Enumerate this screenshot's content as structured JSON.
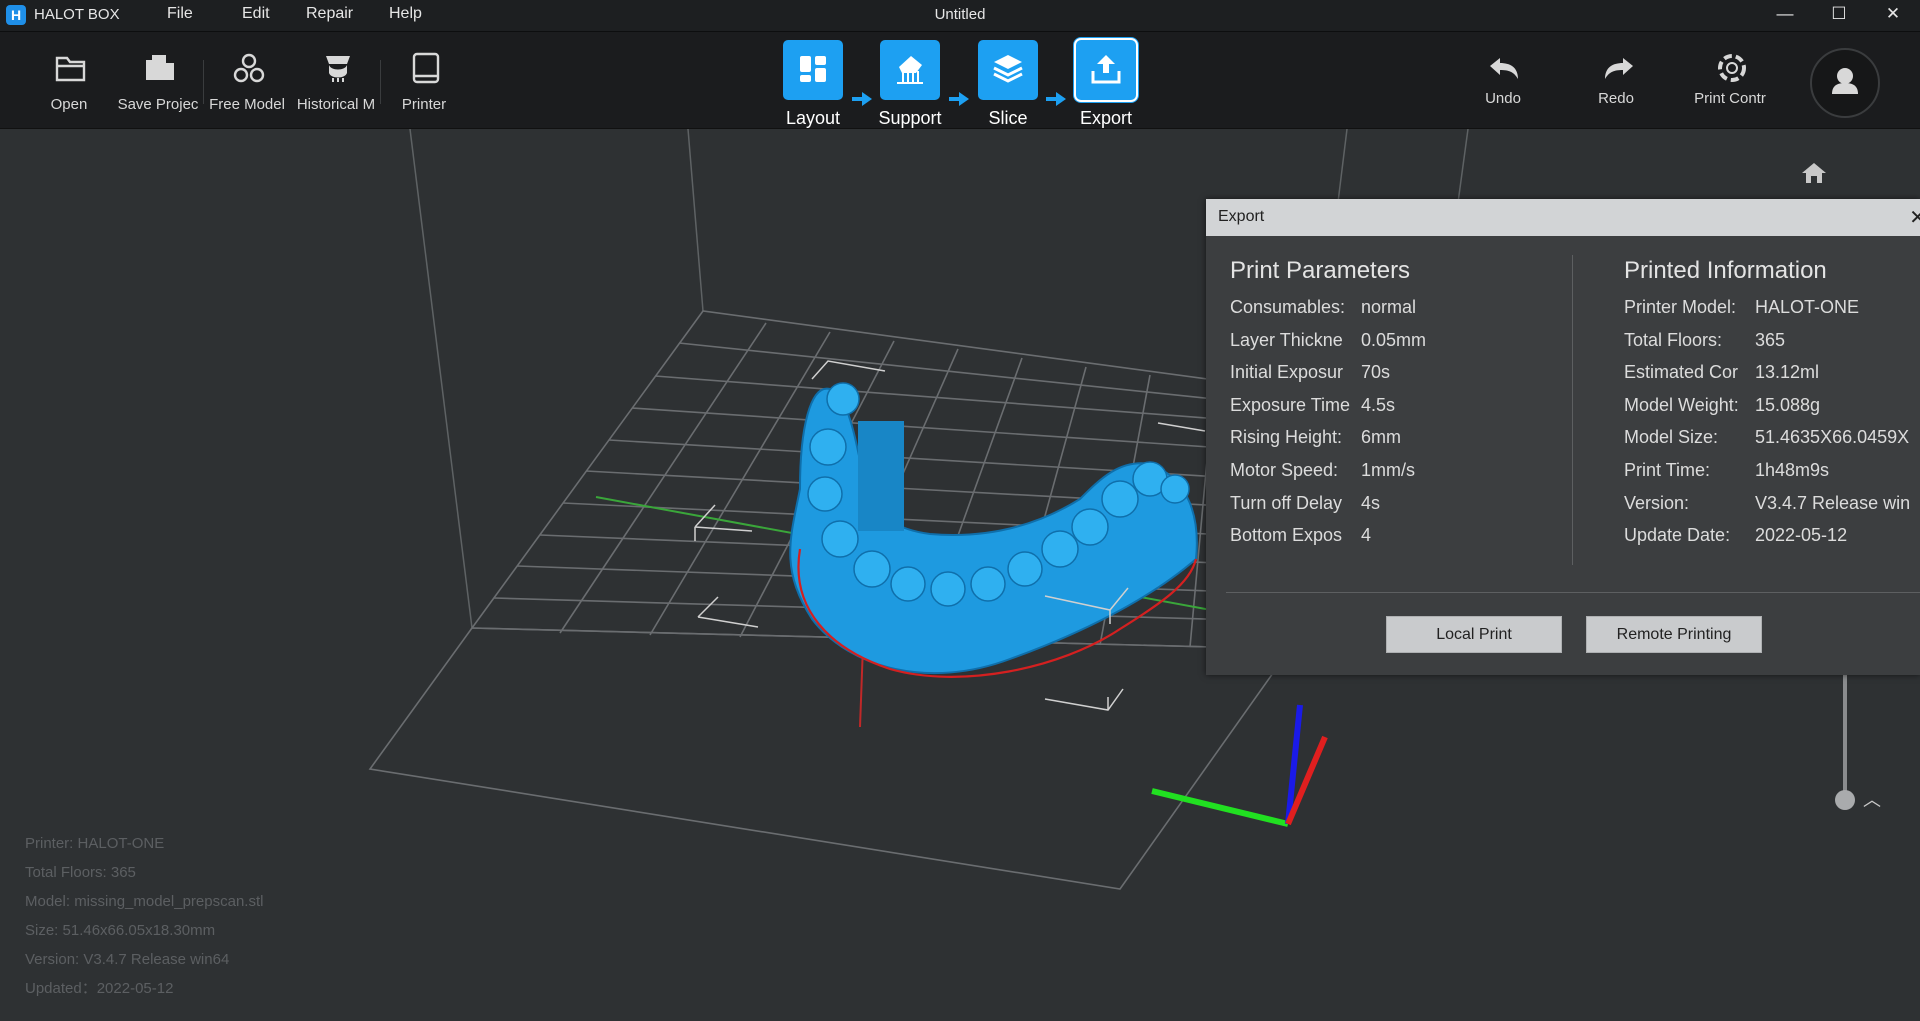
{
  "app": {
    "logo_letter": "H",
    "name": "HALOT BOX",
    "window_title": "Untitled"
  },
  "menu": {
    "file": "File",
    "edit": "Edit",
    "repair": "Repair",
    "help": "Help"
  },
  "window_controls": {
    "minimize": "—",
    "maximize": "☐",
    "close": "✕"
  },
  "toolbar": {
    "open": "Open",
    "save_project": "Save Projec",
    "free_model": "Free Model",
    "historical": "Historical M",
    "printer": "Printer",
    "undo": "Undo",
    "redo": "Redo",
    "print_control": "Print Contr"
  },
  "steps": {
    "layout": "Layout",
    "support": "Support",
    "slice": "Slice",
    "export": "Export",
    "active": "Export"
  },
  "info_panel": {
    "printer": "Printer: HALOT-ONE",
    "total_floors": "Total Floors: 365",
    "model": "Model: missing_model_prepscan.stl",
    "size": "Size: 51.46x66.05x18.30mm",
    "version": "Version: V3.4.7 Release win64",
    "updated": "Updated：2022-05-12"
  },
  "export_dialog": {
    "title": "Export",
    "close": "✕",
    "print_parameters": {
      "heading": "Print Parameters",
      "rows": [
        {
          "label": "Consumables:",
          "value": "normal"
        },
        {
          "label": "Layer Thickne",
          "value": "0.05mm"
        },
        {
          "label": "Initial Exposur",
          "value": "70s"
        },
        {
          "label": "Exposure Time",
          "value": "4.5s"
        },
        {
          "label": "Rising Height:",
          "value": "6mm"
        },
        {
          "label": "Motor Speed:",
          "value": "1mm/s"
        },
        {
          "label": "Turn off Delay",
          "value": "4s"
        },
        {
          "label": "Bottom Expos",
          "value": "4"
        }
      ]
    },
    "printed_information": {
      "heading": "Printed Information",
      "rows": [
        {
          "label": "Printer Model:",
          "value": "HALOT-ONE"
        },
        {
          "label": "Total Floors:",
          "value": "365"
        },
        {
          "label": "Estimated Cor",
          "value": "13.12ml"
        },
        {
          "label": "Model Weight:",
          "value": "15.088g"
        },
        {
          "label": "Model Size:",
          "value": "51.4635X66.0459X"
        },
        {
          "label": "Print Time:",
          "value": "1h48m9s"
        },
        {
          "label": "Version:",
          "value": "V3.4.7 Release win"
        },
        {
          "label": "Update Date:",
          "value": "2022-05-12"
        }
      ]
    },
    "local_print": "Local Print",
    "remote_printing": "Remote Printing"
  },
  "colors": {
    "accent": "#1da0f2",
    "model": "#1e9ae0",
    "axis_x": "#21e021",
    "axis_y": "#e01f1f",
    "axis_z": "#1a1ae8"
  }
}
